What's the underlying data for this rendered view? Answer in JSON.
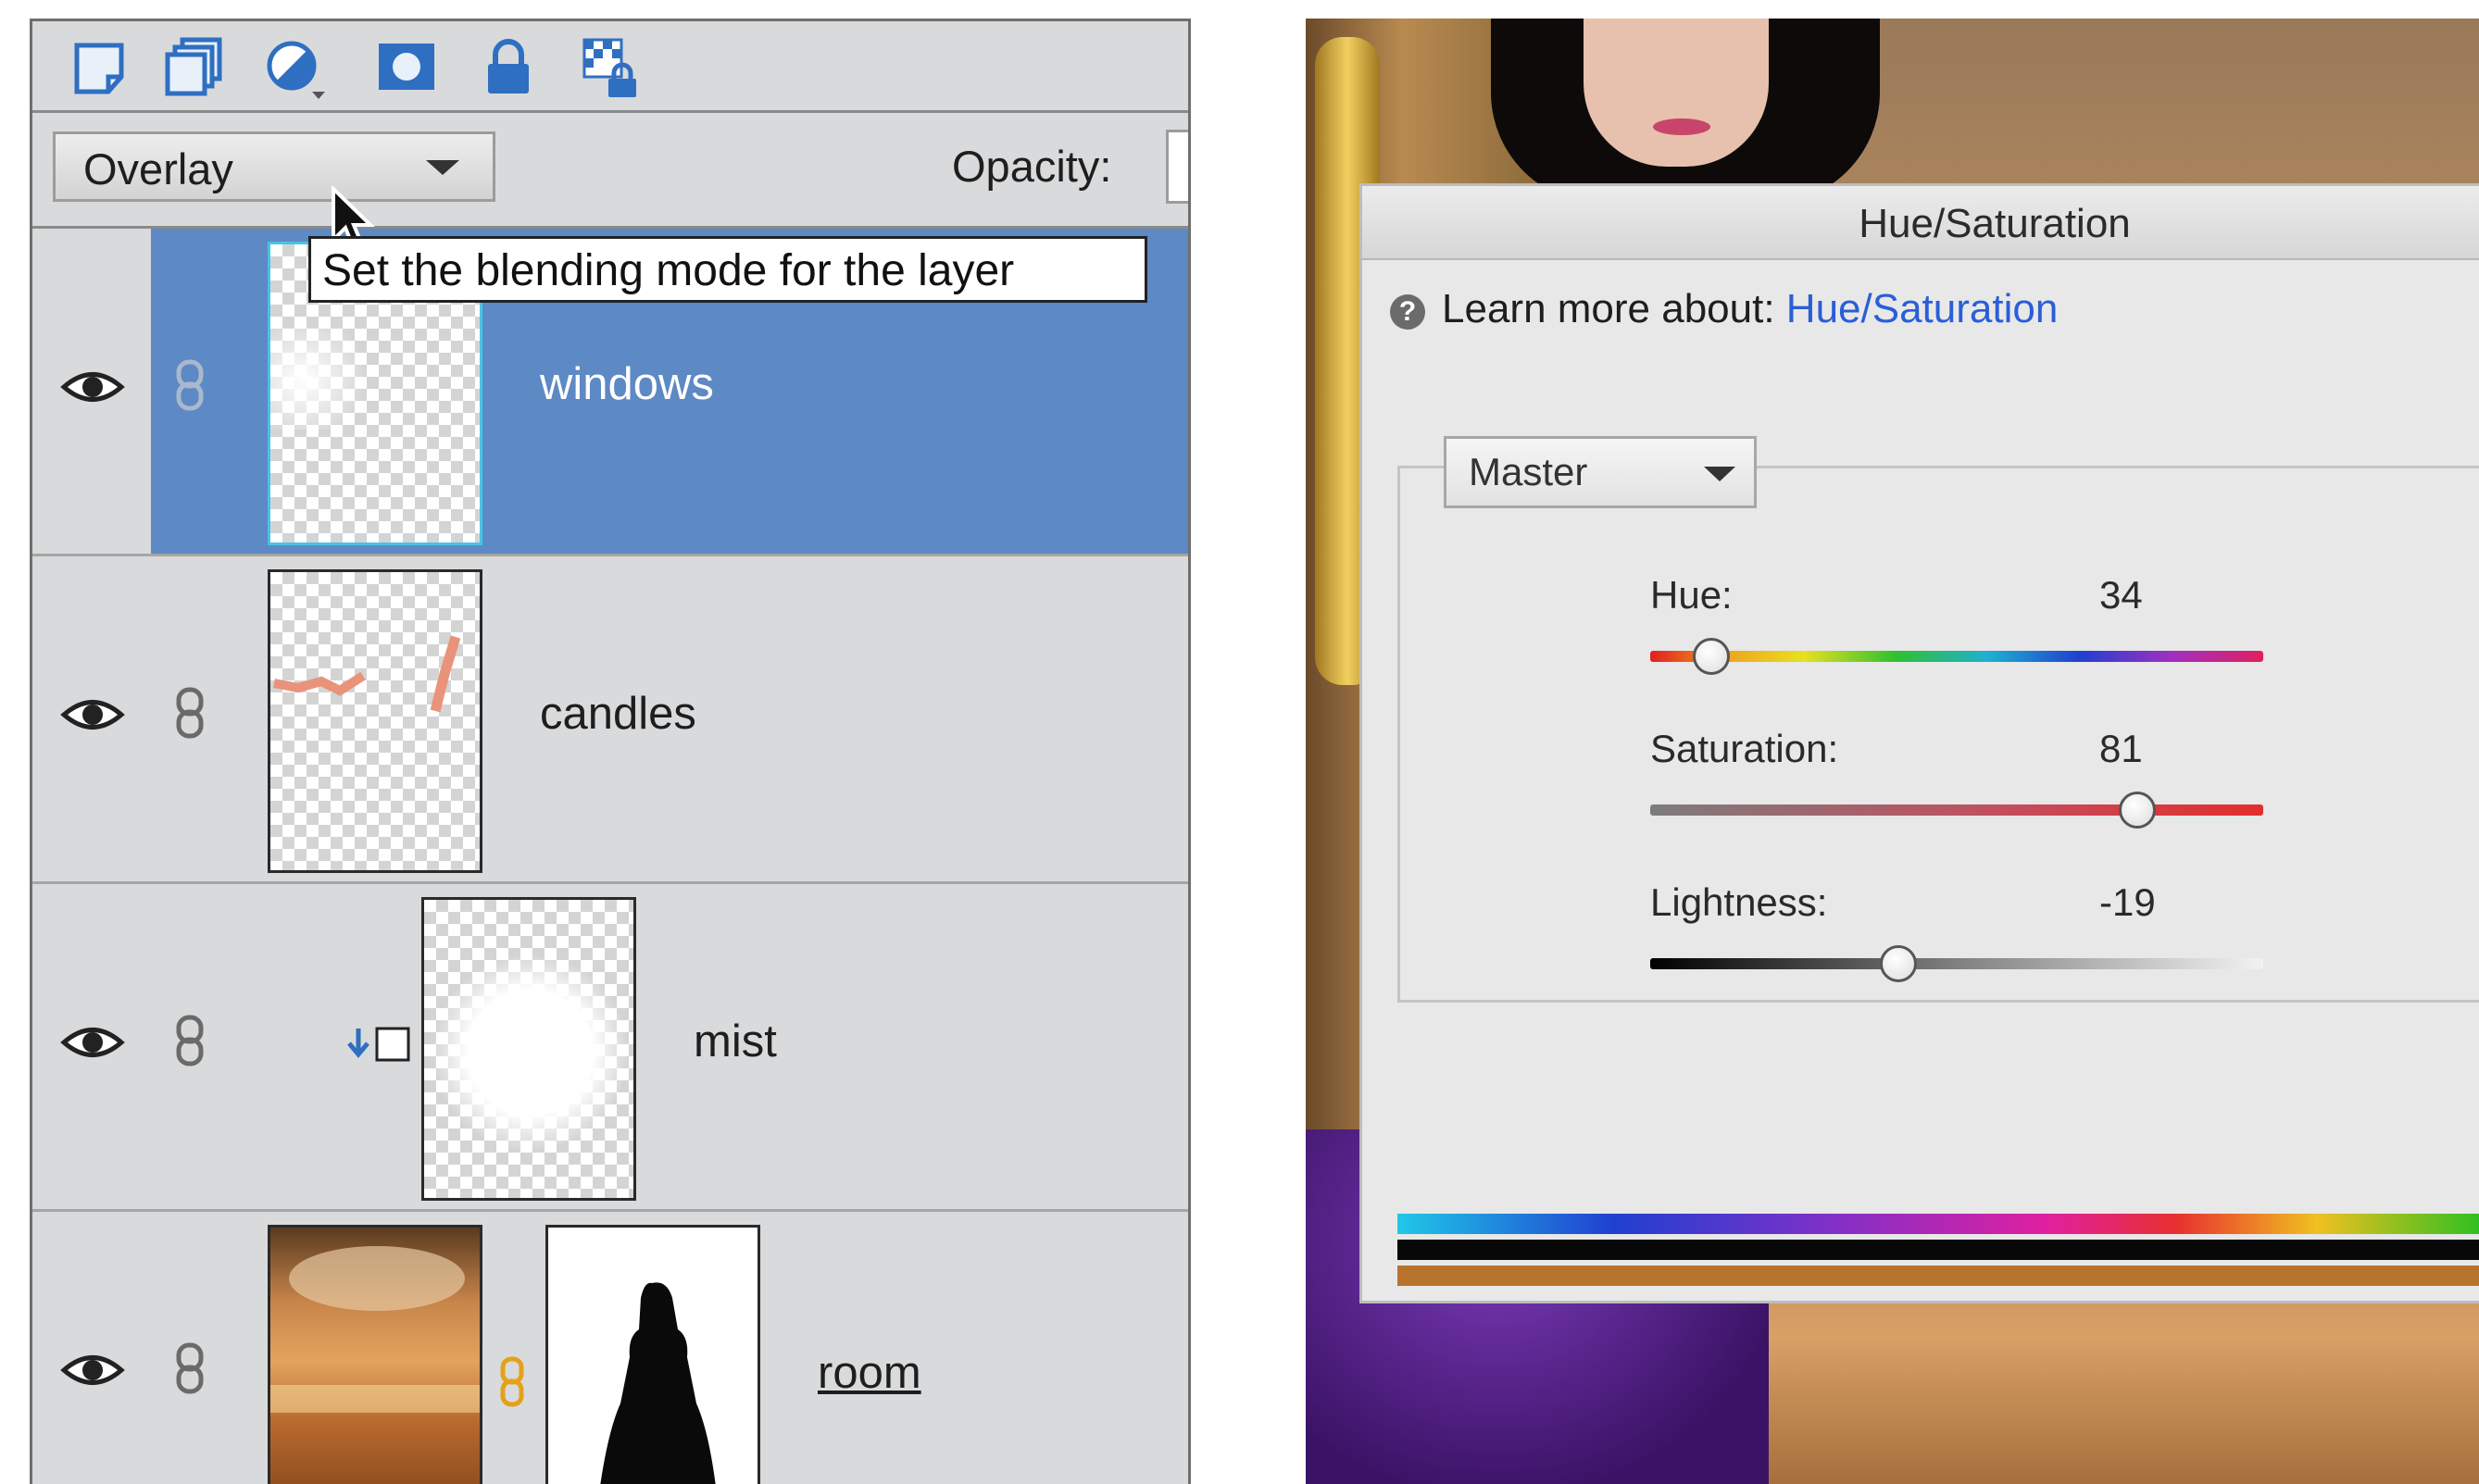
{
  "layers_panel": {
    "toolbar_icons": [
      "new-layer-icon",
      "new-group-icon",
      "adjustment-layer-icon",
      "layer-mask-icon",
      "lock-all-icon",
      "lock-transparency-icon"
    ],
    "blend_mode": "Overlay",
    "opacity_label": "Opacity:",
    "tooltip": "Set the blending mode for the layer",
    "layers": [
      {
        "name": "windows",
        "selected": true
      },
      {
        "name": "candles",
        "selected": false
      },
      {
        "name": "mist",
        "selected": false,
        "clipped": true
      },
      {
        "name": "room",
        "selected": false,
        "has_mask": true
      }
    ]
  },
  "hue_saturation": {
    "title": "Hue/Saturation",
    "learn_prefix": "Learn more about:",
    "learn_link": "Hue/Saturation",
    "channel": "Master",
    "hue": {
      "label": "Hue:",
      "value": "34",
      "slider_fraction": 0.1
    },
    "saturation": {
      "label": "Saturation:",
      "value": "81",
      "slider_fraction": 0.795
    },
    "lightness": {
      "label": "Lightness:",
      "value": "-19",
      "slider_fraction": 0.405
    }
  },
  "colors": {
    "selection_blue": "#5d89c4",
    "link_blue": "#2a5ed8",
    "panel_gray": "#d9dadb",
    "dialog_gray": "#e8e8e8"
  }
}
